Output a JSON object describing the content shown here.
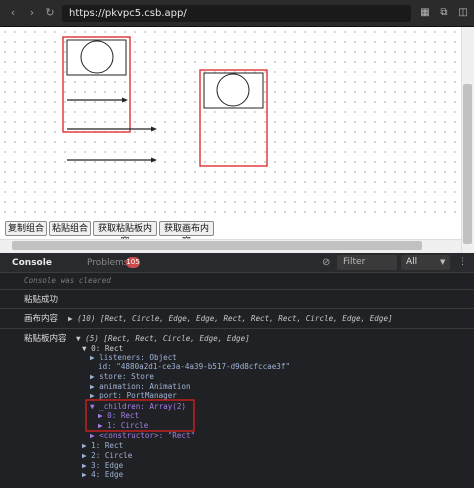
{
  "browser": {
    "url": "https://pkvpc5.csb.app/"
  },
  "toolbar": {
    "copy_group": "复制组合",
    "paste_group": "粘贴组合",
    "get_clipboard": "获取粘贴板内容",
    "get_canvas": "获取画布内容"
  },
  "devtools": {
    "tab_console": "Console",
    "tab_problems": "Problems",
    "problems_count": "105",
    "filter_placeholder": "Filter",
    "level": "All"
  },
  "console": {
    "cleared": "Console was cleared",
    "paste_ok": "粘贴成功",
    "canvas_label": "画布内容",
    "canvas_value": "▶ (10) [Rect, Circle, Edge, Edge, Rect, Rect, Rect, Circle, Edge, Edge]",
    "clip_label": "粘贴板内容",
    "clip_value": "▼ (5) [Rect, Rect, Circle, Edge, Edge]",
    "tree": [
      "▼ 0: Rect",
      "▶ listeners: Object",
      "id: \"4880a2d1-ce3a-4a39-b517-d9d8cfccae3f\"",
      "▶ store: Store",
      "▶ animation: Animation",
      "▶ port: PortManager",
      "▼ _children: Array(2)",
      "▶ 0: Rect",
      "▶ 1: Circle",
      "▶ <constructor>: \"Rect\"",
      "▶ 1: Rect",
      "▶ 2: Circle",
      "▶ 3: Edge",
      "▶ 4: Edge"
    ]
  },
  "colors": {
    "highlight_red": "#e01f1f",
    "canvas_bg": "#ffffff",
    "devtools_bg": "#202124"
  }
}
